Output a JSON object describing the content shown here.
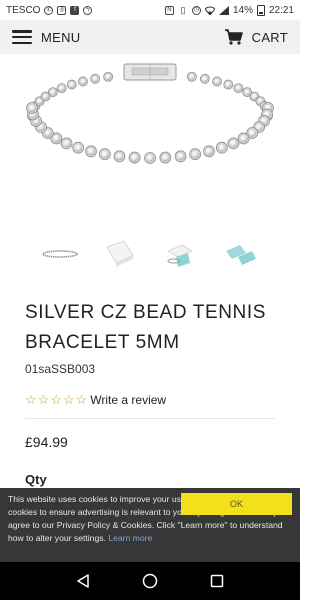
{
  "status_bar": {
    "carrier": "TESCO",
    "battery": "14%",
    "time": "22:21",
    "icons": [
      "whatsapp-icon",
      "instagram-icon",
      "facebook-icon",
      "messenger-icon",
      "nfc-icon",
      "vibrate-icon",
      "alarm-icon",
      "wifi-icon",
      "signal-icon",
      "battery-icon"
    ]
  },
  "header": {
    "menu_label": "MENU",
    "cart_label": "CART"
  },
  "product": {
    "title": "SILVER CZ BEAD TENNIS BRACELET 5MM",
    "sku": "01saSSB003",
    "rating": 0,
    "rating_max": 5,
    "write_review": "Write a review",
    "price": "£94.99",
    "qty_label": "Qty"
  },
  "thumbnails": [
    {
      "name": "bracelet-thumbnail"
    },
    {
      "name": "gift-box-thumbnail"
    },
    {
      "name": "box-and-bracelet-thumbnail"
    },
    {
      "name": "teal-box-thumbnail"
    }
  ],
  "cookie_banner": {
    "text": "This website uses cookies to improve your user experience. We also use cookies to ensure advertising is relevant to you. By using our website you agree to our Privacy Policy & Cookies. Click \"Learn more\" to understand how to alter your settings.",
    "learn_more": "Learn more",
    "ok_label": "OK"
  },
  "colors": {
    "header_bg": "#f1f1f1",
    "star": "#c9a227",
    "ok_button": "#f1e01a",
    "cookie_bg": "#282828",
    "link": "#7fa8d6"
  }
}
